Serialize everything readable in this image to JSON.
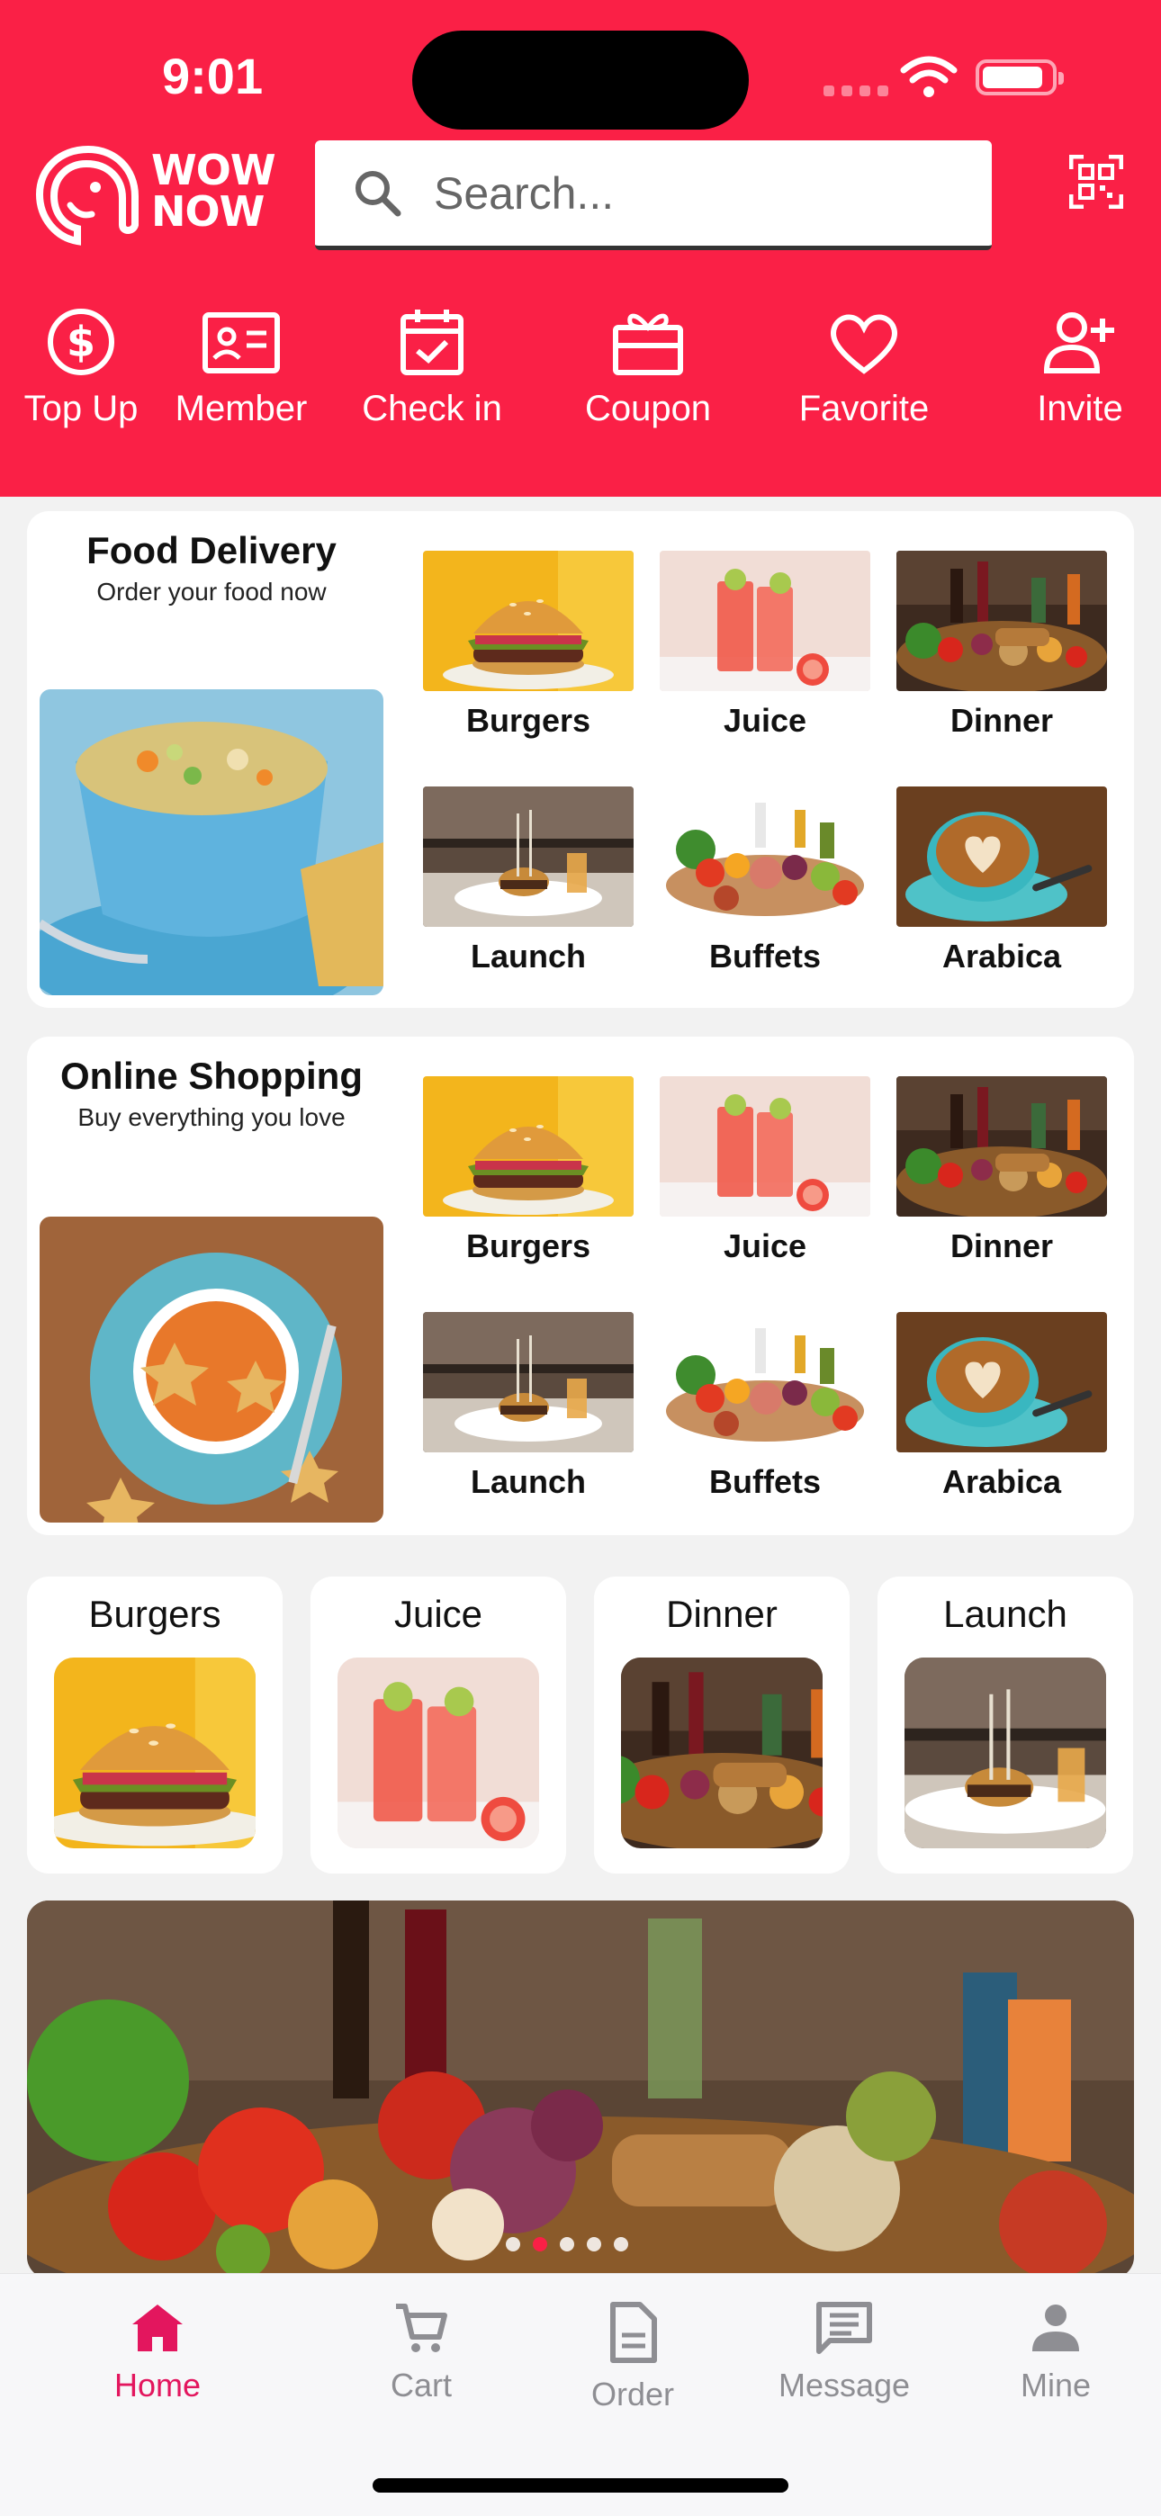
{
  "status": {
    "time": "9:01"
  },
  "brand": {
    "logo_text_line1": "WOW",
    "logo_text_line2": "NOW"
  },
  "search": {
    "placeholder": "Search..."
  },
  "quick_actions": [
    {
      "label": "Top Up",
      "icon": "dollar-circle-icon"
    },
    {
      "label": "Member",
      "icon": "member-card-icon"
    },
    {
      "label": "Check in",
      "icon": "calendar-check-icon"
    },
    {
      "label": "Coupon",
      "icon": "gift-icon"
    },
    {
      "label": "Favorite",
      "icon": "heart-icon"
    },
    {
      "label": "Invite",
      "icon": "add-person-icon"
    }
  ],
  "sections": [
    {
      "title": "Food Delivery",
      "subtitle": "Order your food now",
      "items": [
        "Burgers",
        "Juice",
        "Dinner",
        "Launch",
        "Buffets",
        "Arabica"
      ]
    },
    {
      "title": "Online Shopping",
      "subtitle": "Buy everything you love",
      "items": [
        "Burgers",
        "Juice",
        "Dinner",
        "Launch",
        "Buffets",
        "Arabica"
      ]
    }
  ],
  "category_row": [
    "Burgers",
    "Juice",
    "Dinner",
    "Launch"
  ],
  "banner": {
    "slide_count": 5,
    "active_slide": 1
  },
  "bottom_nav": [
    {
      "label": "Home",
      "icon": "home-icon",
      "active": true
    },
    {
      "label": "Cart",
      "icon": "cart-icon",
      "active": false
    },
    {
      "label": "Order",
      "icon": "document-icon",
      "active": false
    },
    {
      "label": "Message",
      "icon": "message-icon",
      "active": false
    },
    {
      "label": "Mine",
      "icon": "person-icon",
      "active": false
    }
  ],
  "colors": {
    "brand_red": "#fa2046",
    "nav_active": "#e3165e",
    "nav_inactive": "#8e8e93"
  }
}
